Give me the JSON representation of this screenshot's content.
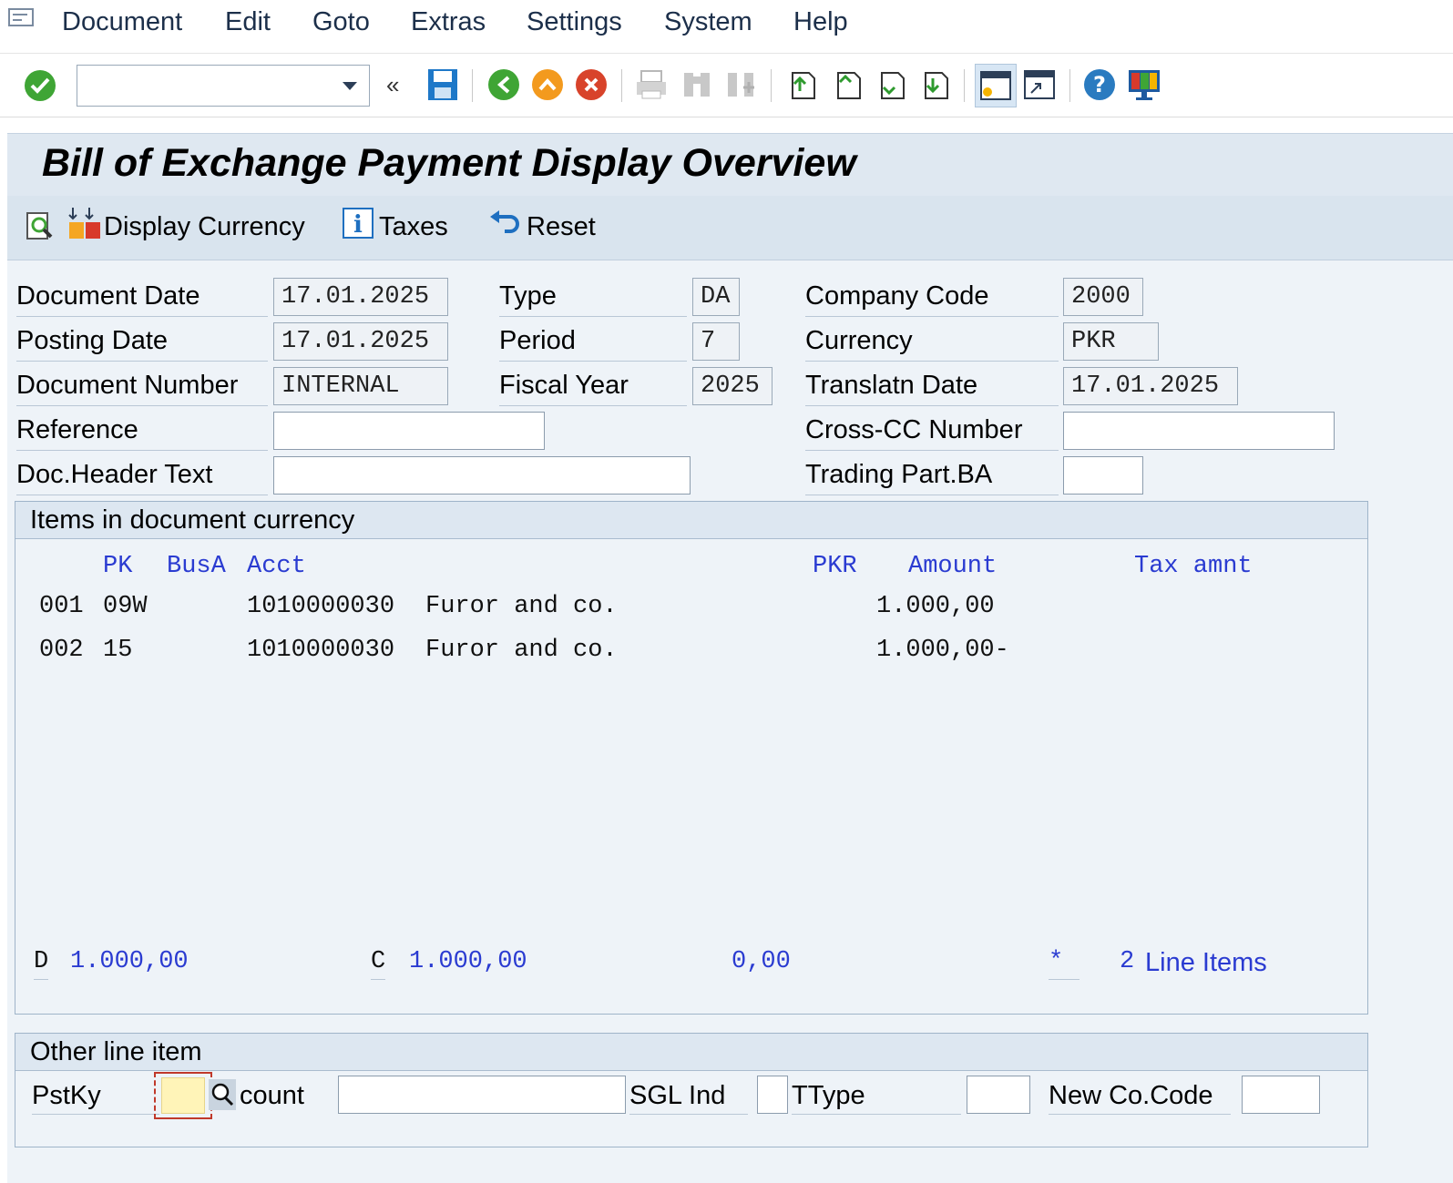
{
  "menu": {
    "items": [
      "Document",
      "Edit",
      "Goto",
      "Extras",
      "Settings",
      "System",
      "Help"
    ]
  },
  "toolbar": {
    "command_value": "",
    "icons": [
      "enter-icon",
      "command-dropdown-icon",
      "collapse-icon",
      "save-icon",
      "back-icon",
      "exit-icon",
      "cancel-icon",
      "print-icon",
      "find-icon",
      "find-next-icon",
      "first-page-icon",
      "previous-page-icon",
      "next-page-icon",
      "last-page-icon",
      "create-session-icon",
      "shortcut-icon",
      "help-icon",
      "customize-layout-icon"
    ]
  },
  "title": "Bill of Exchange Payment Display Overview",
  "app_toolbar": {
    "display_currency": "Display Currency",
    "taxes": "Taxes",
    "reset": "Reset"
  },
  "header": {
    "document_date_label": "Document Date",
    "document_date": "17.01.2025",
    "posting_date_label": "Posting Date",
    "posting_date": "17.01.2025",
    "document_number_label": "Document Number",
    "document_number": "INTERNAL",
    "reference_label": "Reference",
    "reference": "",
    "doc_header_text_label": "Doc.Header Text",
    "doc_header_text": "",
    "type_label": "Type",
    "type": "DA",
    "period_label": "Period",
    "period": "7",
    "fiscal_year_label": "Fiscal Year",
    "fiscal_year": "2025",
    "company_code_label": "Company Code",
    "company_code": "2000",
    "currency_label": "Currency",
    "currency": "PKR",
    "translatn_date_label": "Translatn Date",
    "translatn_date": "17.01.2025",
    "cross_cc_label": "Cross-CC Number",
    "cross_cc": "",
    "trading_part_label": "Trading Part.BA",
    "trading_part": ""
  },
  "items": {
    "title": "Items in document currency",
    "columns": {
      "pk": "PK",
      "busa": "BusA",
      "acct": "Acct",
      "currency": "PKR",
      "amount": "Amount",
      "tax": "Tax amnt"
    },
    "rows": [
      {
        "no": "001",
        "pk": "09W",
        "acct": "1010000030",
        "name": "Furor and co.",
        "amount": "1.000,00"
      },
      {
        "no": "002",
        "pk": "15",
        "acct": "1010000030",
        "name": "Furor and co.",
        "amount": "1.000,00-"
      }
    ],
    "totals": {
      "d_label": "D",
      "d_value": "1.000,00",
      "c_label": "C",
      "c_value": "1.000,00",
      "balance": "0,00",
      "star": "*",
      "line_items_count": "2",
      "line_items_label": "Line Items"
    }
  },
  "other": {
    "title": "Other line item",
    "pstky_label": "PstKy",
    "pstky": "",
    "account_label": "count",
    "account": "",
    "sgl_label": "SGL Ind",
    "sgl": "",
    "ttype_label": "TType",
    "ttype": "",
    "new_cocode_label": "New Co.Code",
    "new_cocode": ""
  }
}
